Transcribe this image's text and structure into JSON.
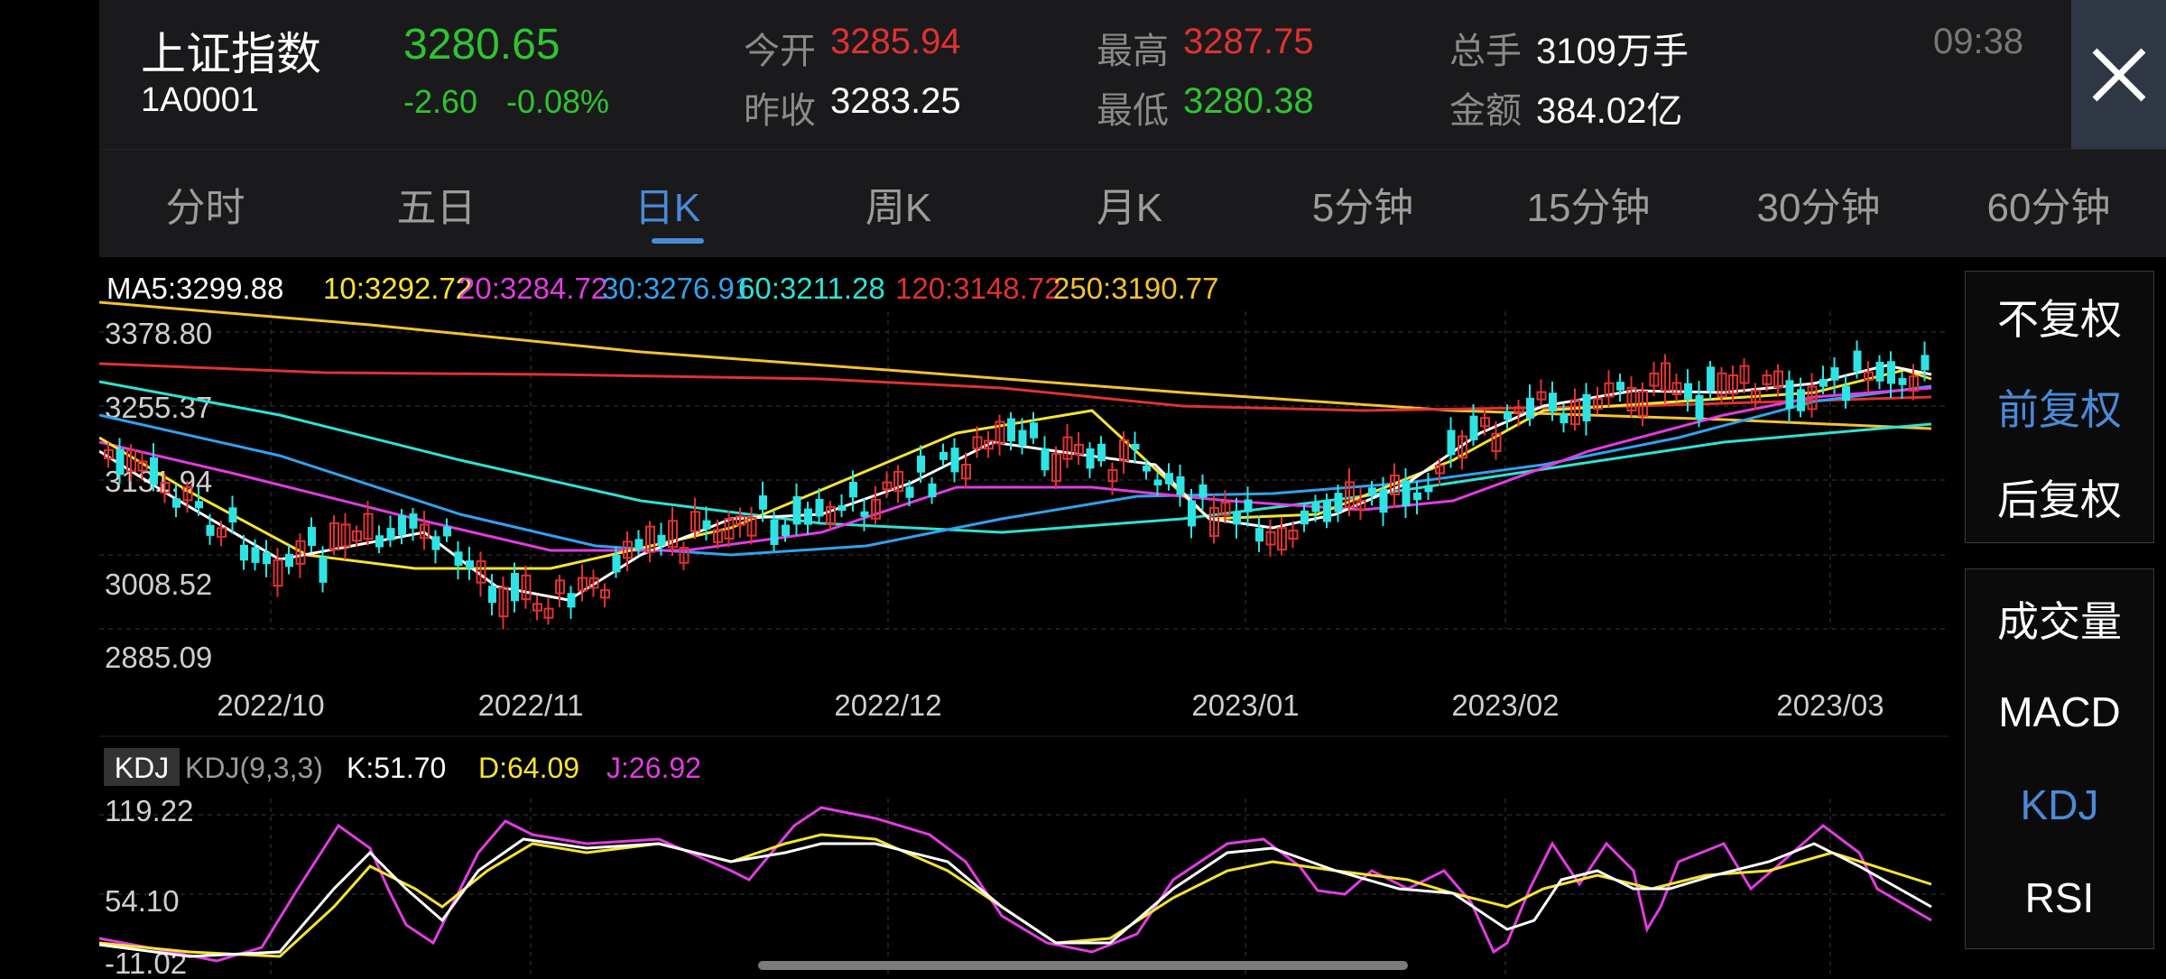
{
  "stock": {
    "name": "上证指数",
    "code": "1A0001",
    "price": "3280.65",
    "change": "-2.60",
    "change_pct": "-0.08%",
    "open_label": "今开",
    "open": "3285.94",
    "prev_close_label": "昨收",
    "prev_close": "3283.25",
    "high_label": "最高",
    "high": "3287.75",
    "low_label": "最低",
    "low": "3280.38",
    "volume_label": "总手",
    "volume": "3109万手",
    "amount_label": "金额",
    "amount": "384.02亿",
    "time": "09:38"
  },
  "close_icon": "close-icon",
  "tabs": [
    {
      "label": "分时"
    },
    {
      "label": "五日"
    },
    {
      "label": "日K",
      "active": true
    },
    {
      "label": "周K"
    },
    {
      "label": "月K"
    },
    {
      "label": "5分钟"
    },
    {
      "label": "15分钟"
    },
    {
      "label": "30分钟"
    },
    {
      "label": "60分钟"
    }
  ],
  "ma_legend": [
    {
      "text": "MA5:3299.88",
      "color": "#ffffff"
    },
    {
      "text": "10:3292.72",
      "color": "#f5e431"
    },
    {
      "text": "20:3284.72",
      "color": "#e23ce2"
    },
    {
      "text": "30:3276.91",
      "color": "#31a2f0"
    },
    {
      "text": "60:3211.28",
      "color": "#2ee3d3"
    },
    {
      "text": "120:3148.72",
      "color": "#e03232"
    },
    {
      "text": "250:3190.77",
      "color": "#f3c230"
    }
  ],
  "main_axis": {
    "y_labels": [
      "3378.80",
      "3255.37",
      "3131.94",
      "3008.52",
      "2885.09"
    ],
    "x_labels": [
      "2022/10",
      "2022/11",
      "2022/12",
      "2023/01",
      "2023/02",
      "2023/03"
    ]
  },
  "kdj": {
    "tag": "KDJ",
    "params": "KDJ(9,3,3)",
    "k": "K:51.70",
    "d": "D:64.09",
    "j": "J:26.92",
    "y_labels": [
      "119.22",
      "54.10",
      "-11.02"
    ]
  },
  "adjust_options": [
    {
      "label": "不复权"
    },
    {
      "label": "前复权",
      "active": true
    },
    {
      "label": "后复权"
    }
  ],
  "indicator_options": [
    {
      "label": "成交量"
    },
    {
      "label": "MACD"
    },
    {
      "label": "KDJ",
      "active": true
    },
    {
      "label": "RSI"
    }
  ],
  "colors": {
    "up": "#e03232",
    "down": "#2ee3e3",
    "price_green": "#2fc430",
    "price_red": "#e03232",
    "accent": "#4a8bd8",
    "ma5": "#ffffff",
    "ma10": "#f5e431",
    "ma20": "#e23ce2",
    "ma30": "#31a2f0",
    "ma60": "#2ee3d3",
    "ma120": "#e03232",
    "ma250": "#f3c230"
  }
}
